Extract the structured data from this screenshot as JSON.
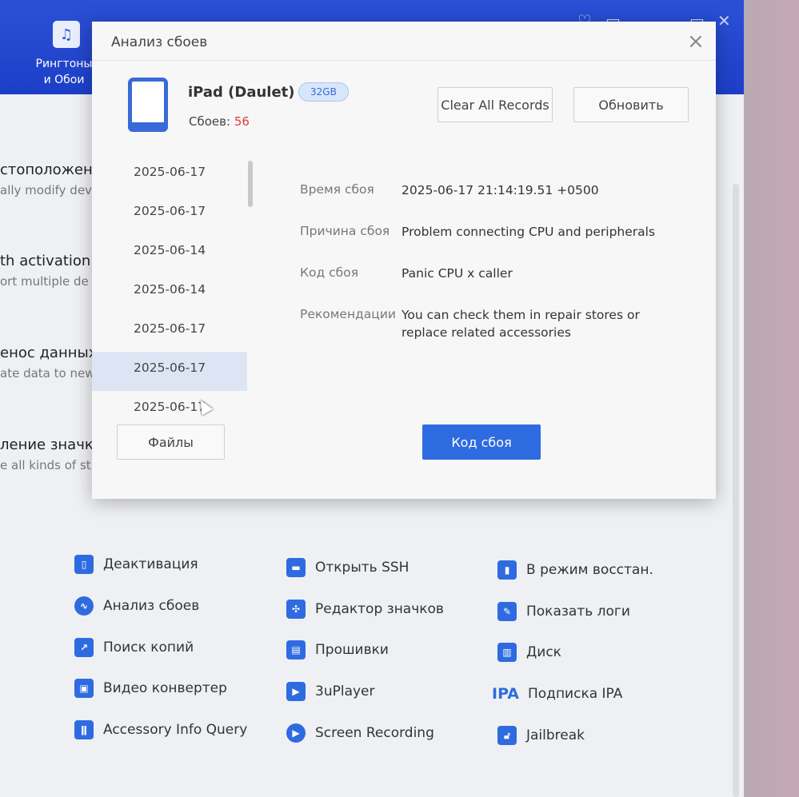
{
  "top_nav": {
    "item_label_line1": "Рингтоны",
    "item_label_line2": "и Обои"
  },
  "background_features": [
    {
      "title": "стоположение",
      "subtitle": "ally modify dev"
    },
    {
      "title": "th activation",
      "subtitle": "ort multiple de"
    },
    {
      "title": "енос данных",
      "subtitle": "ate data to new"
    },
    {
      "title": "ление значко",
      "subtitle": "e all kinds of st"
    }
  ],
  "dialog": {
    "title": "Анализ сбоев",
    "close_symbol": "×",
    "device_name": "iPad (Daulet)",
    "storage_badge": "32GB",
    "crash_count_label": "Сбоев:",
    "crash_count_value": "56",
    "clear_button": "Clear All Records",
    "refresh_button": "Обновить",
    "dates": [
      "2025-06-17",
      "2025-06-17",
      "2025-06-14",
      "2025-06-14",
      "2025-06-17",
      "2025-06-17",
      "2025-06-17"
    ],
    "selected_index": 5,
    "details": {
      "time_label": "Время сбоя",
      "time_value": "2025-06-17 21:14:19.51 +0500",
      "reason_label": "Причина сбоя",
      "reason_value": "Problem connecting CPU and peripherals",
      "code_label": "Код сбоя",
      "code_value": "Panic CPU x caller",
      "recommend_label": "Рекомендации",
      "recommend_value": "You can check them in repair stores or replace related accessories"
    },
    "files_button": "Файлы",
    "crash_code_button": "Код сбоя"
  },
  "tools": [
    {
      "label": "Деактивация",
      "icon": "phone-icon"
    },
    {
      "label": "Анализ сбоев",
      "icon": "pulse-icon"
    },
    {
      "label": "Поиск копий",
      "icon": "chart-icon"
    },
    {
      "label": "Видео конвертер",
      "icon": "toolbox-icon"
    },
    {
      "label": "Accessory Info Query",
      "icon": "plug-icon"
    },
    {
      "label": "Открыть SSH",
      "icon": "terminal-icon"
    },
    {
      "label": "Редактор значков",
      "icon": "grid-icon"
    },
    {
      "label": "Прошивки",
      "icon": "firmware-icon"
    },
    {
      "label": "3uPlayer",
      "icon": "play-icon"
    },
    {
      "label": "Screen Recording",
      "icon": "record-icon"
    },
    {
      "label": "В режим восстан.",
      "icon": "recovery-icon"
    },
    {
      "label": "Показать логи",
      "icon": "log-icon"
    },
    {
      "label": "Диск",
      "icon": "disk-icon"
    },
    {
      "label": "Подписка IPA",
      "icon": "ipa-icon",
      "icon_text": "IPA"
    },
    {
      "label": "Jailbreak",
      "icon": "lock-icon"
    }
  ],
  "colors": {
    "accent": "#2f6be0",
    "topbar": "#1d3fc8",
    "crash_count": "#e23b3b"
  }
}
